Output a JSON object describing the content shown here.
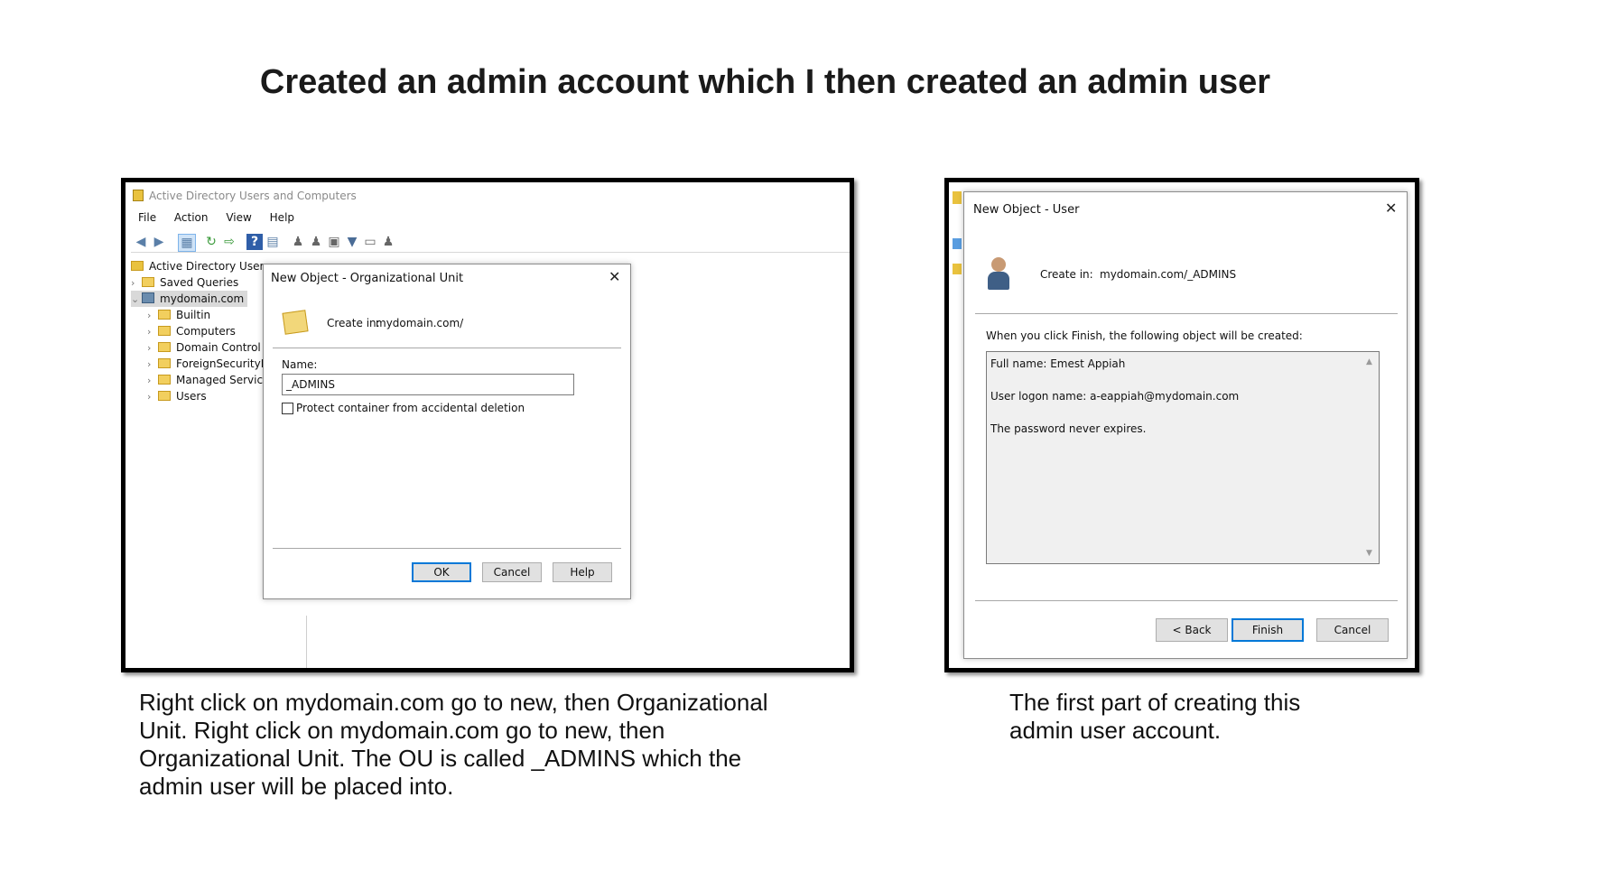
{
  "slide": {
    "title": "Created an admin account which I then created an admin user",
    "caption_left": "Right click on mydomain.com go to new, then Organizational Unit. Right click on mydomain.com go to new, then Organizational Unit. The OU is called _ADMINS which the admin user will be placed into.",
    "caption_right": "The first part of creating this admin user account."
  },
  "ad_window": {
    "title": "Active Directory Users and Computers",
    "menu": [
      "File",
      "Action",
      "View",
      "Help"
    ],
    "tree": [
      {
        "label": "Active Directory Users a",
        "icon": "ad-root-icon"
      },
      {
        "label": "Saved Queries",
        "icon": "folder-icon"
      },
      {
        "label": "mydomain.com",
        "icon": "domain-icon"
      },
      {
        "label": "Builtin",
        "icon": "folder-icon"
      },
      {
        "label": "Computers",
        "icon": "folder-icon"
      },
      {
        "label": "Domain Control",
        "icon": "folder-icon"
      },
      {
        "label": "ForeignSecurityP",
        "icon": "folder-icon"
      },
      {
        "label": "Managed Servic",
        "icon": "folder-icon"
      },
      {
        "label": "Users",
        "icon": "folder-icon"
      }
    ]
  },
  "ou_dialog": {
    "title": "New Object - Organizational Unit",
    "close": "✕",
    "create_in_label": "Create in:",
    "create_in_value": "mydomain.com/",
    "name_label": "Name:",
    "name_value": "_ADMINS",
    "protect_label": "Protect container from accidental deletion",
    "protect_checked": false,
    "ok": "OK",
    "cancel": "Cancel",
    "help": "Help"
  },
  "user_dialog": {
    "title": "New Object - User",
    "close": "✕",
    "create_in_label": "Create in:",
    "create_in_value": "mydomain.com/_ADMINS",
    "intro": "When you click Finish, the following object will be created:",
    "summary": [
      "Full name: Emest Appiah",
      "User logon name: a-eappiah@mydomain.com",
      "The password never expires."
    ],
    "back": "< Back",
    "finish": "Finish",
    "cancel": "Cancel"
  },
  "colors": {
    "accent": "#0078d7",
    "folder": "#f2cf5e"
  }
}
